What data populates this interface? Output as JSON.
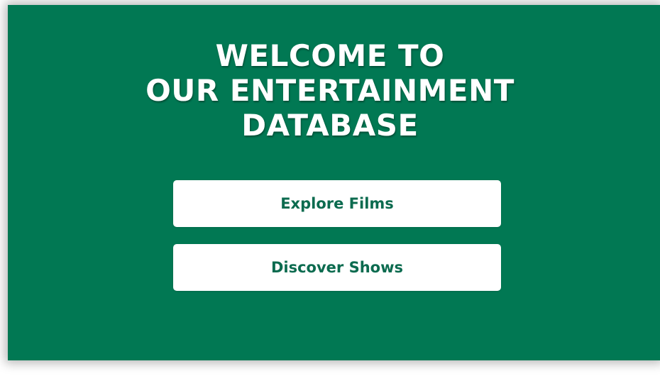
{
  "hero": {
    "title_lines": [
      "WELCOME TO",
      "OUR ENTERTAINMENT",
      "DATABASE"
    ]
  },
  "actions": {
    "explore_films_label": "Explore Films",
    "discover_shows_label": "Discover Shows"
  },
  "colors": {
    "panel_background": "#017853",
    "button_background": "#ffffff",
    "button_text": "#0c6b4f",
    "title_text": "#ffffff"
  }
}
